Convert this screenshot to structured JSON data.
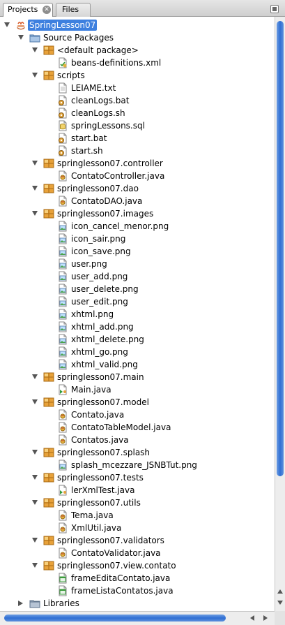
{
  "tabs": [
    {
      "label": "Projects",
      "active": true
    },
    {
      "label": "Files",
      "active": false
    }
  ],
  "tree": [
    {
      "label": "SpringLesson07",
      "icon": "project-icon",
      "depth": 0,
      "toggle": "open",
      "selected": true
    },
    {
      "label": "Source Packages",
      "icon": "source-folder-icon",
      "depth": 1,
      "toggle": "open"
    },
    {
      "label": "<default package>",
      "icon": "package-icon",
      "depth": 2,
      "toggle": "open"
    },
    {
      "label": "beans-definitions.xml",
      "icon": "xml-file-icon",
      "depth": 3
    },
    {
      "label": "scripts",
      "icon": "package-icon",
      "depth": 2,
      "toggle": "open"
    },
    {
      "label": "LEIAME.txt",
      "icon": "text-file-icon",
      "depth": 3
    },
    {
      "label": "cleanLogs.bat",
      "icon": "script-file-icon",
      "depth": 3
    },
    {
      "label": "cleanLogs.sh",
      "icon": "script-file-icon",
      "depth": 3
    },
    {
      "label": "springLessons.sql",
      "icon": "sql-file-icon",
      "depth": 3
    },
    {
      "label": "start.bat",
      "icon": "script-file-icon",
      "depth": 3
    },
    {
      "label": "start.sh",
      "icon": "script-file-icon",
      "depth": 3
    },
    {
      "label": "springlesson07.controller",
      "icon": "package-icon",
      "depth": 2,
      "toggle": "open"
    },
    {
      "label": "ContatoController.java",
      "icon": "java-file-icon",
      "depth": 3
    },
    {
      "label": "springlesson07.dao",
      "icon": "package-icon",
      "depth": 2,
      "toggle": "open"
    },
    {
      "label": "ContatoDAO.java",
      "icon": "java-file-icon",
      "depth": 3
    },
    {
      "label": "springlesson07.images",
      "icon": "package-icon",
      "depth": 2,
      "toggle": "open"
    },
    {
      "label": "icon_cancel_menor.png",
      "icon": "image-file-icon",
      "depth": 3
    },
    {
      "label": "icon_sair.png",
      "icon": "image-file-icon",
      "depth": 3
    },
    {
      "label": "icon_save.png",
      "icon": "image-file-icon",
      "depth": 3
    },
    {
      "label": "user.png",
      "icon": "image-file-icon",
      "depth": 3
    },
    {
      "label": "user_add.png",
      "icon": "image-file-icon",
      "depth": 3
    },
    {
      "label": "user_delete.png",
      "icon": "image-file-icon",
      "depth": 3
    },
    {
      "label": "user_edit.png",
      "icon": "image-file-icon",
      "depth": 3
    },
    {
      "label": "xhtml.png",
      "icon": "image-file-icon",
      "depth": 3
    },
    {
      "label": "xhtml_add.png",
      "icon": "image-file-icon",
      "depth": 3
    },
    {
      "label": "xhtml_delete.png",
      "icon": "image-file-icon",
      "depth": 3
    },
    {
      "label": "xhtml_go.png",
      "icon": "image-file-icon",
      "depth": 3
    },
    {
      "label": "xhtml_valid.png",
      "icon": "image-file-icon",
      "depth": 3
    },
    {
      "label": "springlesson07.main",
      "icon": "package-icon",
      "depth": 2,
      "toggle": "open"
    },
    {
      "label": "Main.java",
      "icon": "java-main-icon",
      "depth": 3
    },
    {
      "label": "springlesson07.model",
      "icon": "package-icon",
      "depth": 2,
      "toggle": "open"
    },
    {
      "label": "Contato.java",
      "icon": "java-file-icon",
      "depth": 3
    },
    {
      "label": "ContatoTableModel.java",
      "icon": "java-file-icon",
      "depth": 3
    },
    {
      "label": "Contatos.java",
      "icon": "java-file-icon",
      "depth": 3
    },
    {
      "label": "springlesson07.splash",
      "icon": "package-icon",
      "depth": 2,
      "toggle": "open"
    },
    {
      "label": "splash_mcezzare_JSNBTut.png",
      "icon": "image-file-icon",
      "depth": 3
    },
    {
      "label": "springlesson07.tests",
      "icon": "package-icon",
      "depth": 2,
      "toggle": "open"
    },
    {
      "label": "lerXmlTest.java",
      "icon": "java-main-icon",
      "depth": 3
    },
    {
      "label": "springlesson07.utils",
      "icon": "package-icon",
      "depth": 2,
      "toggle": "open"
    },
    {
      "label": "Tema.java",
      "icon": "java-file-icon",
      "depth": 3
    },
    {
      "label": "XmlUtil.java",
      "icon": "java-file-icon",
      "depth": 3
    },
    {
      "label": "springlesson07.validators",
      "icon": "package-icon",
      "depth": 2,
      "toggle": "open"
    },
    {
      "label": "ContatoValidator.java",
      "icon": "java-file-icon",
      "depth": 3
    },
    {
      "label": "springlesson07.view.contato",
      "icon": "package-icon",
      "depth": 2,
      "toggle": "open"
    },
    {
      "label": "frameEditaContato.java",
      "icon": "java-form-icon",
      "depth": 3
    },
    {
      "label": "frameListaContatos.java",
      "icon": "java-form-icon",
      "depth": 3
    },
    {
      "label": "Libraries",
      "icon": "library-folder-icon",
      "depth": 1,
      "toggle": "closed"
    }
  ],
  "colors": {
    "selection": "#3d80df",
    "scroll_thumb": "#2f6fd3",
    "package_orange": "#e8a23a"
  },
  "scroll": {
    "vertical_fraction_visible": 0.77,
    "horizontal_fraction_visible": 0.82
  }
}
